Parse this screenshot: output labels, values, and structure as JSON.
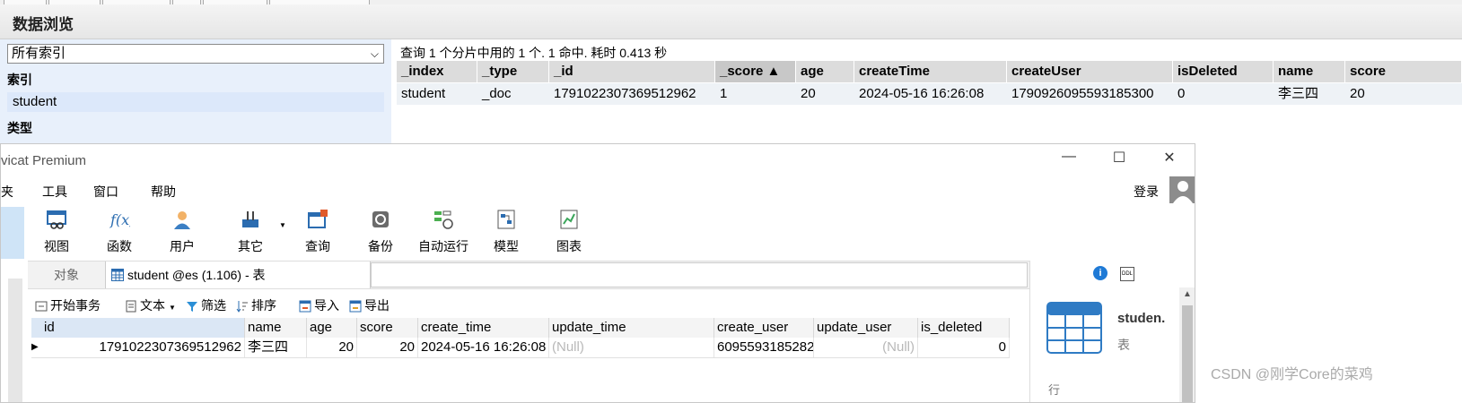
{
  "es_browser": {
    "title": "数据浏览",
    "index_select": "所有索引",
    "section_index": "索引",
    "index_item": "student",
    "section_type": "类型",
    "query_info": "查询 1 个分片中用的 1 个. 1 命中. 耗时 0.413 秒",
    "columns": [
      "_index",
      "_type",
      "_id",
      "_score ▲",
      "age",
      "createTime",
      "createUser",
      "isDeleted",
      "name",
      "score"
    ],
    "row": [
      "student",
      "_doc",
      "1791022307369512962",
      "1",
      "20",
      "2024-05-16 16:26:08",
      "1790926095593185300",
      "0",
      "李三四",
      "20"
    ]
  },
  "navicat": {
    "window_title": "vicat Premium",
    "window_buttons": {
      "minimize": "—",
      "maximize": "☐",
      "close": "✕"
    },
    "menu": [
      "夹",
      "工具",
      "窗口",
      "帮助"
    ],
    "login": "登录",
    "toolbar": [
      {
        "label": "视图",
        "icon": "view-icon"
      },
      {
        "label": "函数",
        "icon": "function-icon"
      },
      {
        "label": "用户",
        "icon": "user-icon"
      },
      {
        "label": "其它",
        "icon": "tools-icon"
      },
      {
        "label": "查询",
        "icon": "query-icon"
      },
      {
        "label": "备份",
        "icon": "backup-icon"
      },
      {
        "label": "自动运行",
        "icon": "auto-run-icon"
      },
      {
        "label": "模型",
        "icon": "model-icon"
      },
      {
        "label": "图表",
        "icon": "chart-icon"
      }
    ],
    "tabs": {
      "objects": "对象",
      "active": "student @es (1.106) - 表"
    },
    "subtoolbar": [
      "开始事务",
      "文本",
      "筛选",
      "排序",
      "导入",
      "导出"
    ],
    "grid_columns": [
      "id",
      "name",
      "age",
      "score",
      "create_time",
      "update_time",
      "create_user",
      "update_user",
      "is_deleted"
    ],
    "grid_row": [
      "1791022307369512962",
      "李三四",
      "20",
      "20",
      "2024-05-16 16:26:08",
      "(Null)",
      "6095593185282",
      "(Null)",
      "0"
    ],
    "right_panel": {
      "name": "studen.",
      "type": "表",
      "row_label": "行"
    }
  },
  "watermark": "CSDN @刚学Core的菜鸡",
  "colors": {
    "accent": "#1f7ad6",
    "selection": "#cfe4f7",
    "es_header": "#dcdcdc"
  }
}
